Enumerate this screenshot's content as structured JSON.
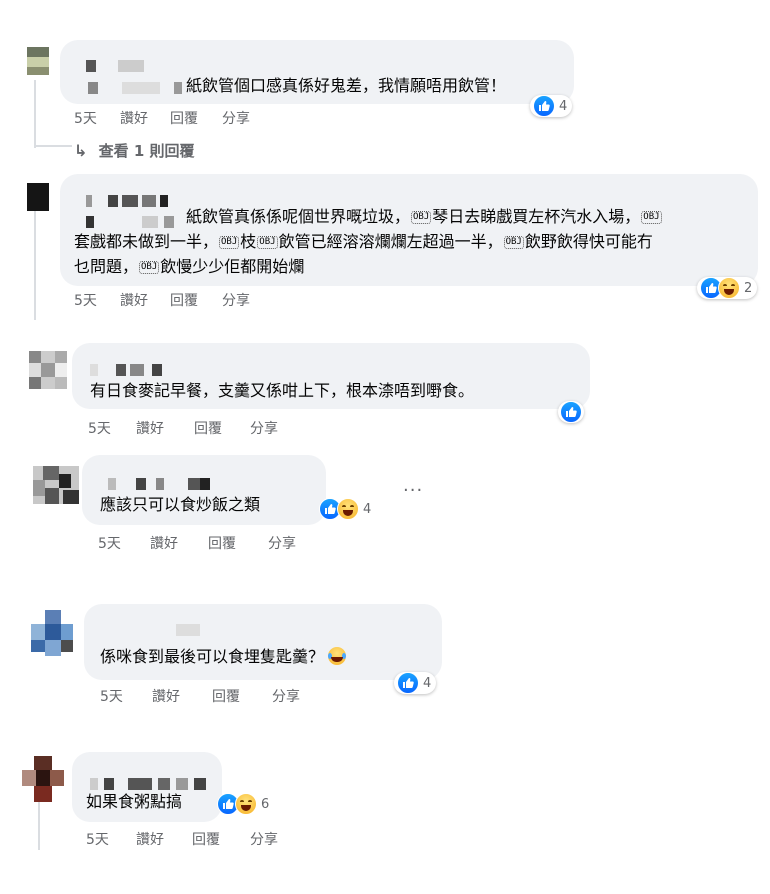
{
  "comments": [
    {
      "text": "紙飲管個口感真係好鬼差，我情願唔用飲管！",
      "time": "5天",
      "like": "讚好",
      "reply": "回覆",
      "share": "分享",
      "reaction_count": "4",
      "reactions": [
        "like"
      ],
      "view_replies": "查看 1 則回覆"
    },
    {
      "text_line1": "紙飲管真係係呢個世界嘅垃圾，",
      "badge": "OBJ",
      "text_line1b": "琴日去睇戲買左杯汽水入場，",
      "text_line2a": "套戲都未做到一半，",
      "text_line2b": "枝",
      "text_line2c": "飲管已經溶溶爛爛左超過一半，",
      "text_line2d": "飲野飲得快可能冇",
      "text_line3a": "乜問題，",
      "text_line3b": "飲慢少少佢都開始爛",
      "time": "5天",
      "like": "讚好",
      "reply": "回覆",
      "share": "分享",
      "reaction_count": "2",
      "reactions": [
        "like",
        "haha"
      ]
    },
    {
      "text": "有日食麥記早餐，支羹又係咁上下，根本渿唔到嘢食。",
      "time": "5天",
      "like": "讚好",
      "reply": "回覆",
      "share": "分享",
      "reactions": [
        "like"
      ]
    },
    {
      "text": "應該只可以食炒飯之類",
      "time": "5天",
      "like": "讚好",
      "reply": "回覆",
      "share": "分享",
      "reaction_count": "4",
      "reactions": [
        "like",
        "haha"
      ],
      "more": "···"
    },
    {
      "text": "係咪食到最後可以食埋隻匙羹？",
      "time": "5天",
      "like": "讚好",
      "reply": "回覆",
      "share": "分享",
      "reaction_count": "4",
      "reactions": [
        "like"
      ]
    },
    {
      "text": "如果食粥點搞",
      "time": "5天",
      "like": "讚好",
      "reply": "回覆",
      "share": "分享",
      "reaction_count": "6",
      "reactions": [
        "like",
        "haha"
      ]
    }
  ],
  "colors": {
    "bubble": "#f0f2f5",
    "meta": "#65676b",
    "like_blue": "#0866ff"
  }
}
